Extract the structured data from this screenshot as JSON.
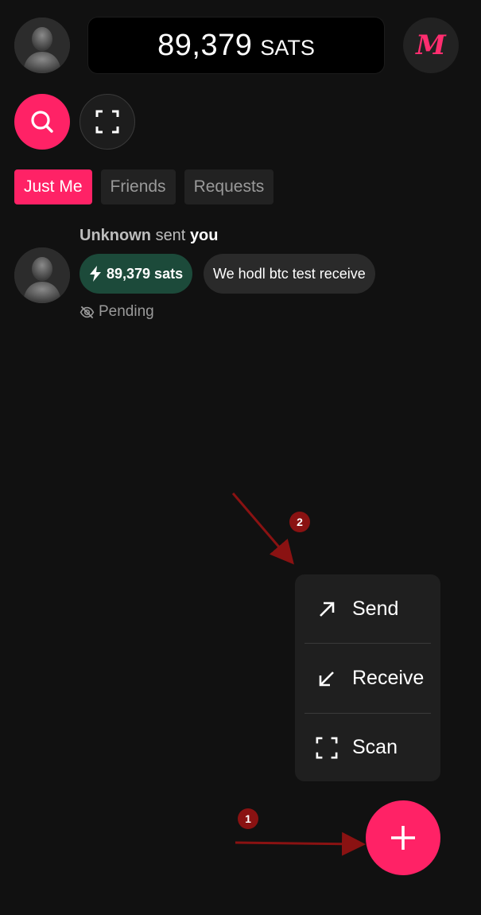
{
  "header": {
    "balance_amount": "89,379",
    "balance_unit": "SATS",
    "brand_letter": "M"
  },
  "tabs": [
    {
      "label": "Just Me",
      "active": true
    },
    {
      "label": "Friends",
      "active": false
    },
    {
      "label": "Requests",
      "active": false
    }
  ],
  "feed": [
    {
      "sender": "Unknown",
      "verb": "sent",
      "recipient": "you",
      "amount": "89,379 sats",
      "memo": "We hodl btc test receive",
      "status": "Pending"
    }
  ],
  "menu": {
    "items": [
      {
        "label": "Send",
        "icon": "arrow-up-right-icon"
      },
      {
        "label": "Receive",
        "icon": "arrow-down-left-icon"
      },
      {
        "label": "Scan",
        "icon": "scan-icon"
      }
    ]
  },
  "annotations": {
    "badge_1": "1",
    "badge_2": "2"
  },
  "colors": {
    "accent": "#ff2266",
    "background": "#111111",
    "amount_pill": "#1c4a3a",
    "annotation": "#8a1212"
  }
}
